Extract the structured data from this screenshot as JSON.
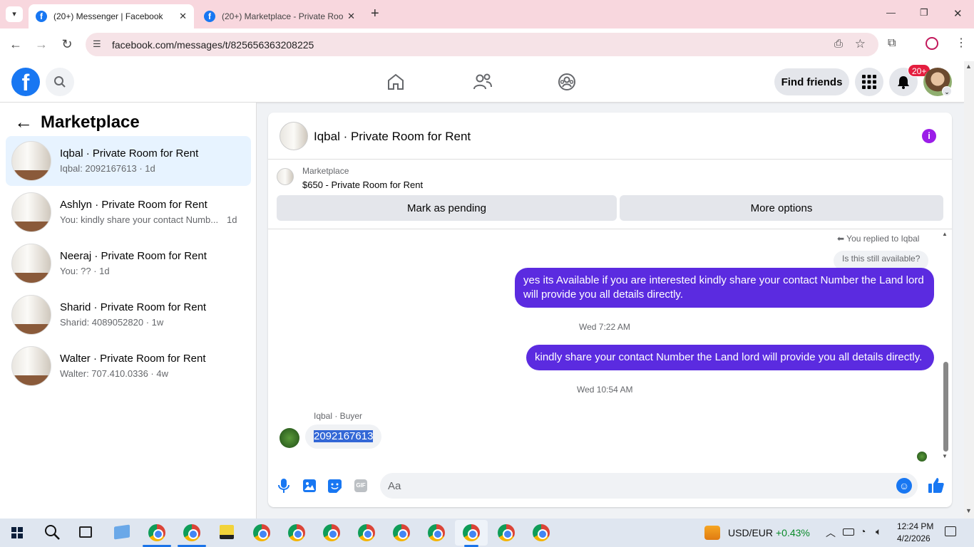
{
  "browser": {
    "tabs": [
      {
        "title": "(20+) Messenger | Facebook",
        "active": true
      },
      {
        "title": "(20+) Marketplace - Private Roo",
        "active": false
      }
    ],
    "new_tab": "+",
    "url": "facebook.com/messages/t/825656363208225",
    "window_controls": {
      "minimize": "—",
      "restore": "❐",
      "close": "✕"
    }
  },
  "fb_header": {
    "logo": "f",
    "find_friends": "Find friends",
    "notif_badge": "20+"
  },
  "sidebar": {
    "title": "Marketplace",
    "back": "←",
    "conversations": [
      {
        "name": "Iqbal · Private Room for Rent",
        "preview": "Iqbal: 2092167613 · 1d",
        "selected": true
      },
      {
        "name": "Ashlyn · Private Room for Rent",
        "preview": "You: kindly share your contact Numb...",
        "time": "1d",
        "selected": false
      },
      {
        "name": "Neeraj · Private Room for Rent",
        "preview": "You: ?? · 1d",
        "selected": false
      },
      {
        "name": "Sharid · Private Room for Rent",
        "preview": "Sharid: 4089052820 · 1w",
        "selected": false
      },
      {
        "name": "Walter · Private Room for Rent",
        "preview": "Walter: 707.410.0336 · 4w",
        "selected": false
      }
    ]
  },
  "chat": {
    "title": "Iqbal · Private Room for Rent",
    "listing_label": "Marketplace",
    "listing_title": "$650 - Private Room for Rent",
    "mark_pending": "Mark as pending",
    "more_options": "More options",
    "replied_to": "You replied to Iqbal",
    "quoted": "Is this still available?",
    "msg1": "yes its Available if you are interested kindly share your contact Number the Land lord will provide you all details directly.",
    "ts1": "Wed 7:22 AM",
    "msg2": "kindly share your contact Number the Land lord will provide you all details directly.",
    "ts2": "Wed 10:54 AM",
    "buyer_label": "Iqbal · Buyer",
    "buyer_msg": "2092167613",
    "composer_placeholder": "Aa"
  },
  "taskbar": {
    "currency": "USD/EUR",
    "change": "+0.43%",
    "time": "12:24 PM",
    "date": "4/2/2026"
  },
  "colors": {
    "fb_blue": "#1877f2",
    "bubble": "#5b2be0",
    "tab_bg": "#f8d7de",
    "positive": "#0a8a2a"
  }
}
